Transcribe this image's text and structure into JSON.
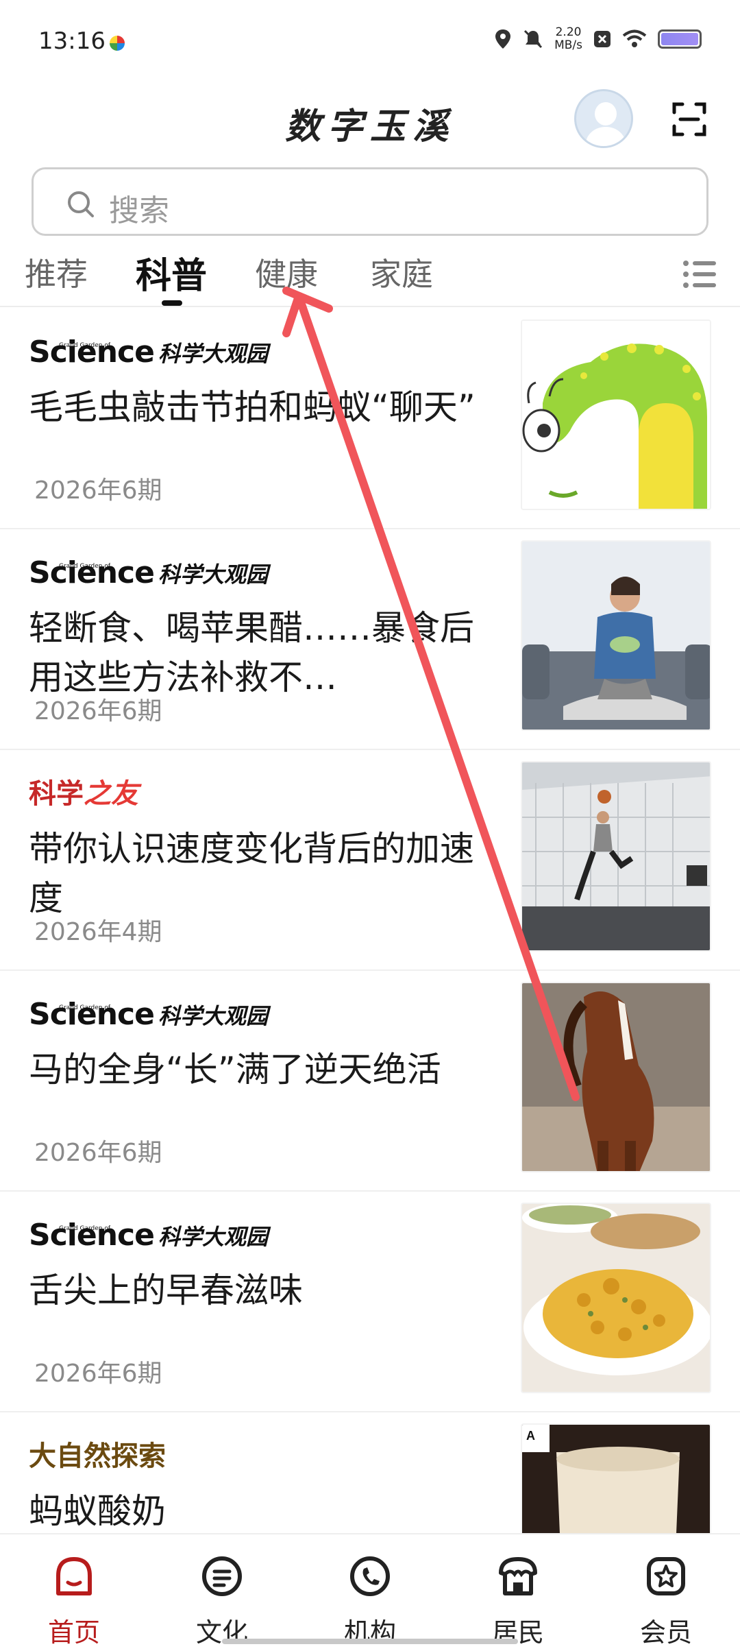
{
  "status_bar": {
    "time": "13:16",
    "net_speed_value": "2.20",
    "net_speed_unit": "MB/s",
    "icons": [
      "location-icon",
      "mute-icon",
      "close-box-icon",
      "wifi-icon",
      "battery-icon"
    ]
  },
  "header": {
    "app_title": "数字玉溪"
  },
  "search": {
    "placeholder": "搜索"
  },
  "tabs": [
    {
      "label": "推荐",
      "active": false
    },
    {
      "label": "科普",
      "active": true
    },
    {
      "label": "健康",
      "active": false
    },
    {
      "label": "家庭",
      "active": false
    }
  ],
  "articles": [
    {
      "source": "science",
      "source_text_en": "Science",
      "source_text_cn": "科学大观园",
      "source_tag": "Grand Garden of",
      "title": "毛毛虫敲击节拍和蚂蚁“聊天”",
      "issue": "2026年6期",
      "thumb": "caterpillar"
    },
    {
      "source": "science",
      "source_text_en": "Science",
      "source_text_cn": "科学大观园",
      "source_tag": "Grand Garden of",
      "title": "轻断食、喝苹果醋……暴食后用这些方法补救不…",
      "issue": "2026年6期",
      "thumb": "woman-salad"
    },
    {
      "source": "kxzy",
      "source_text_a": "科学",
      "source_text_b": "之友",
      "title": "带你认识速度变化背后的加速度",
      "issue": "2026年4期",
      "thumb": "basketball"
    },
    {
      "source": "science",
      "source_text_en": "Science",
      "source_text_cn": "科学大观园",
      "source_tag": "Grand Garden of",
      "title": "马的全身“长”满了逆天绝活",
      "issue": "2026年6期",
      "thumb": "horse"
    },
    {
      "source": "science",
      "source_text_en": "Science",
      "source_text_cn": "科学大观园",
      "source_tag": "Grand Garden of",
      "title": "舌尖上的早春滋味",
      "issue": "2026年6期",
      "thumb": "food-plate"
    },
    {
      "source": "dzr",
      "source_text": "大自然探索",
      "title": "蚂蚁酸奶",
      "issue": "",
      "thumb": "yogurt"
    }
  ],
  "bottom_nav": [
    {
      "label": "首页",
      "icon": "home-icon",
      "active": true
    },
    {
      "label": "文化",
      "icon": "document-icon",
      "active": false
    },
    {
      "label": "机构",
      "icon": "phone-icon",
      "active": false
    },
    {
      "label": "居民",
      "icon": "residents-icon",
      "active": false
    },
    {
      "label": "会员",
      "icon": "member-star-icon",
      "active": false
    }
  ],
  "colors": {
    "accent_red": "#b71c1c",
    "annotation_arrow": "#f0555a"
  }
}
